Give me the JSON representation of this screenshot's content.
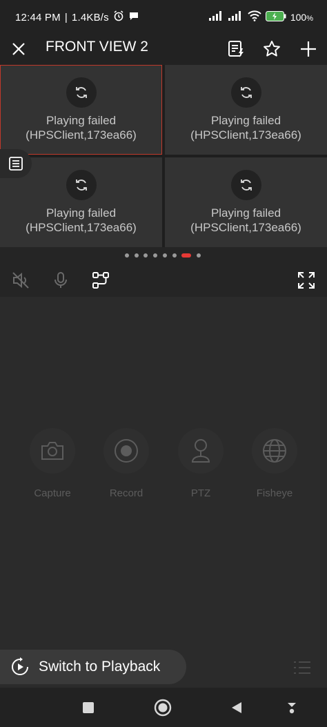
{
  "status": {
    "time": "12:44 PM",
    "speed": "1.4KB/s",
    "battery": "100"
  },
  "header": {
    "title": "FRONT VIEW 2"
  },
  "tiles": [
    {
      "line1": "Playing failed",
      "line2": "(HPSClient,173ea66)"
    },
    {
      "line1": "Playing failed",
      "line2": "(HPSClient,173ea66)"
    },
    {
      "line1": "Playing failed",
      "line2": "(HPSClient,173ea66)"
    },
    {
      "line1": "Playing failed",
      "line2": "(HPSClient,173ea66)"
    }
  ],
  "pagination": {
    "pages": 8,
    "active_index": 6
  },
  "actions": [
    {
      "label": "Capture",
      "icon": "camera-icon"
    },
    {
      "label": "Record",
      "icon": "record-icon"
    },
    {
      "label": "PTZ",
      "icon": "ptz-icon"
    },
    {
      "label": "Fisheye",
      "icon": "globe-icon"
    }
  ],
  "playback": {
    "label": "Switch to Playback"
  },
  "colors": {
    "selected_border": "#c0392b",
    "active_dot": "#e53935",
    "background": "#2b2b2b"
  }
}
